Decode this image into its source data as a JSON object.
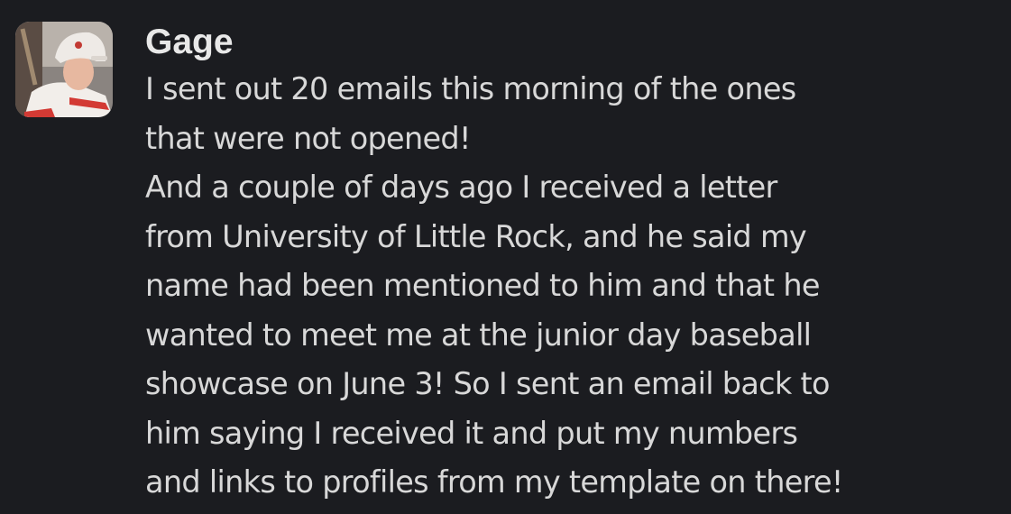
{
  "message": {
    "sender": "Gage",
    "avatar_icon": "baseball-player-avatar",
    "lines": [
      "I sent out 20 emails this morning of the ones",
      "that were not opened!",
      "And a couple of days ago I received a letter",
      "from University of Little Rock, and he said my",
      "name had been mentioned to him and that he",
      "wanted to meet me at the junior day baseball",
      "showcase on June 3! So I sent an email back to",
      "him saying I received it and put my numbers",
      "and links to profiles from my template on there!"
    ]
  },
  "colors": {
    "background": "#1b1c20",
    "text": "#d8d8d8",
    "sender": "#e8e8e8"
  }
}
